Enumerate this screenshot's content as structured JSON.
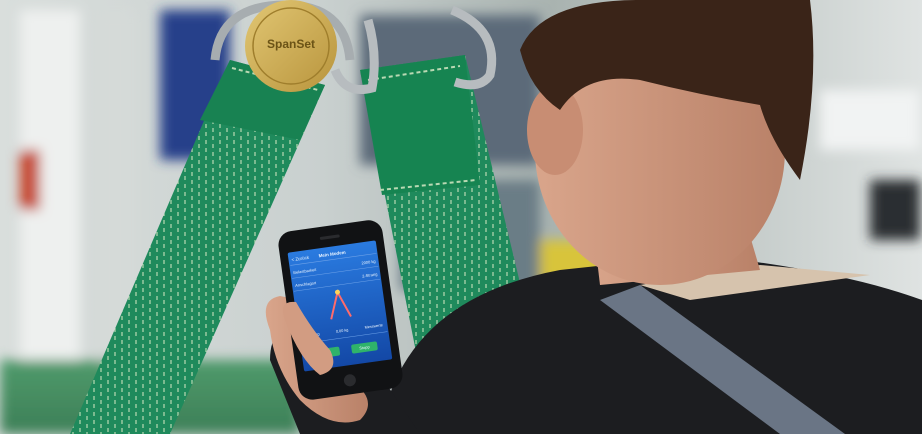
{
  "photo": {
    "description_free": true
  },
  "tag": {
    "brand_text": "SpanSet"
  },
  "phone_screen": {
    "nav_back": "< Zurück",
    "nav_title": "Mein Modem",
    "row1_label": "Belastbarkeit",
    "row1_value": "2000 kg",
    "row2_label": "Anschlagart",
    "row2_value": "2-Strang",
    "stat1": "0,00 kg",
    "stat2": "0,00 kg",
    "stat3": "Messwerte",
    "button1": "Start",
    "button2": "Stopp"
  },
  "colors": {
    "sling_green": "#1f8a5c",
    "sling_stitch": "#b9d9b3",
    "screen_blue": "#1c62c8",
    "shirt": "#1c1d20",
    "hair": "#3a2418"
  }
}
